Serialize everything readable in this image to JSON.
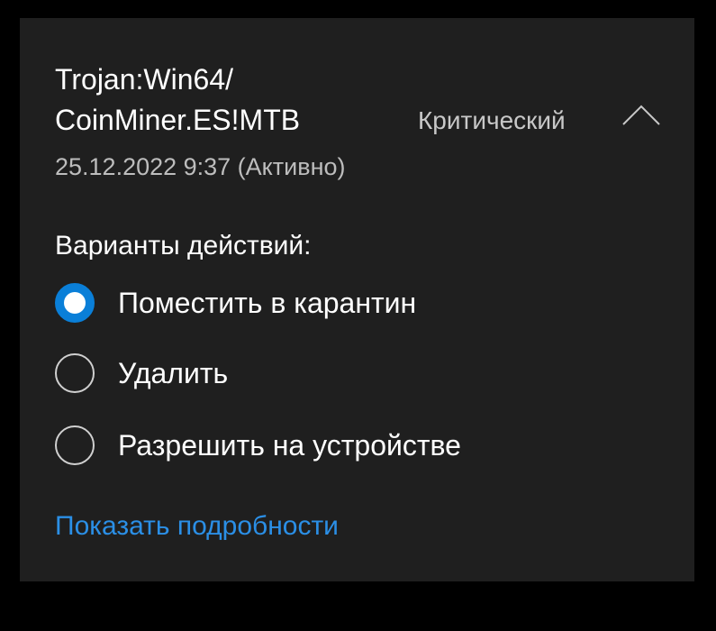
{
  "threat": {
    "name_line1": "Trojan:Win64/",
    "name_line2": "CoinMiner.ES!MTB",
    "date_status": "25.12.2022 9:37 (Активно)",
    "severity": "Критический",
    "expand_icon": "chevron-up-icon"
  },
  "actions": {
    "title": "Варианты действий:",
    "options": [
      {
        "label": "Поместить в карантин",
        "selected": true
      },
      {
        "label": "Удалить",
        "selected": false
      },
      {
        "label": "Разрешить на устройстве",
        "selected": false
      }
    ]
  },
  "details_link": "Показать подробности",
  "colors": {
    "background": "#000000",
    "panel": "#1f1f1f",
    "accent": "#0a7fd8",
    "link": "#2b8fe6",
    "text_primary": "#ffffff",
    "text_secondary": "#bdbdbd"
  }
}
